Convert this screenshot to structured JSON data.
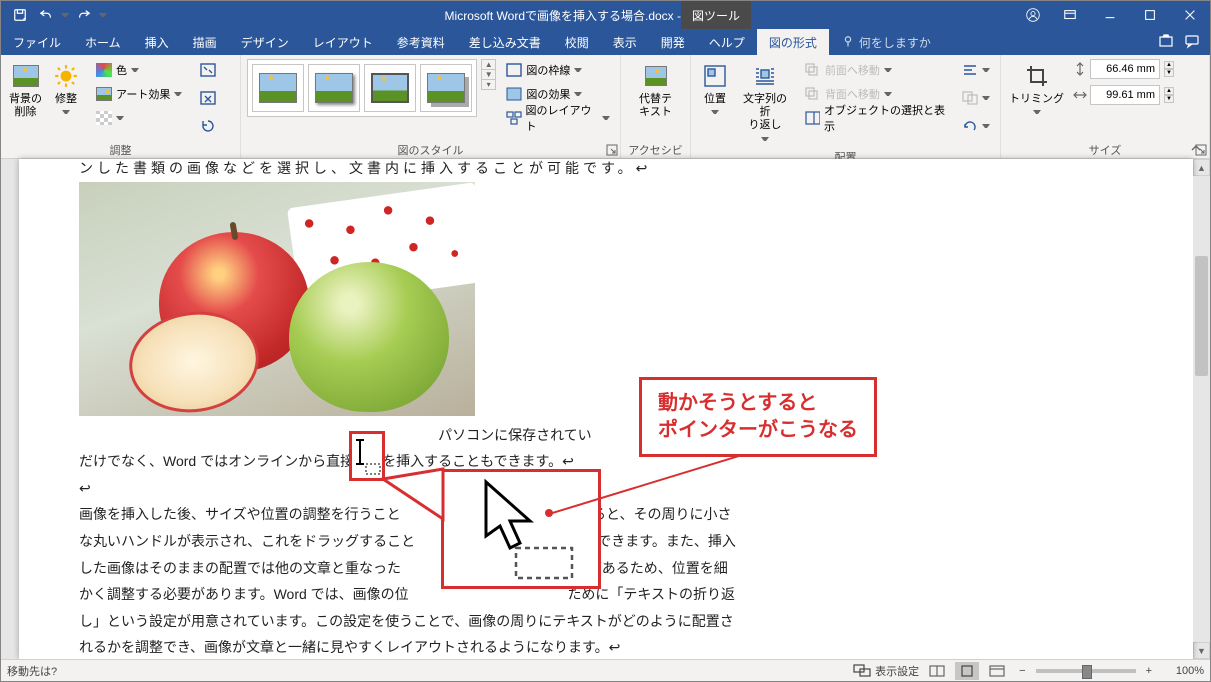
{
  "titlebar": {
    "doc_title": "Microsoft Wordで画像を挿入する場合.docx  -  Word",
    "tool_tab": "図ツール"
  },
  "tabs": {
    "file": "ファイル",
    "home": "ホーム",
    "insert": "挿入",
    "draw": "描画",
    "design": "デザイン",
    "layout": "レイアウト",
    "references": "参考資料",
    "mailings": "差し込み文書",
    "review": "校閲",
    "view": "表示",
    "developer": "開発",
    "help": "ヘルプ",
    "format": "図の形式",
    "tell_me": "何をしますか"
  },
  "ribbon": {
    "remove_bg": "背景の\n削除",
    "corrections": "修整",
    "color": "色",
    "art_effects": "アート効果",
    "group_adjust": "調整",
    "group_styles": "図のスタイル",
    "border": "図の枠線",
    "effects": "図の効果",
    "layout_pic": "図のレイアウト",
    "alt_text": "代替テ\nキスト",
    "group_accessibility": "アクセシビリティ",
    "position": "位置",
    "wrap": "文字列の折\nり返し",
    "bring_forward": "前面へ移動",
    "send_backward": "背面へ移動",
    "selection_pane": "オブジェクトの選択と表示",
    "group_arrange": "配置",
    "crop": "トリミング",
    "height_value": "66.46 mm",
    "width_value": "99.61 mm",
    "group_size": "サイズ"
  },
  "doc": {
    "line1": "ンした書類の画像などを選択し、文書内に挿入することが可能です。",
    "line2_left": "だけでなく、Word ではオンラインから",
    "line2_mid": "直接",
    "line2_right": "画像を挿入することもできます。",
    "line2_pre": "パソコンに保存されてい",
    "p1a": "画像を挿入した後、サイズや位置の調整を行うこと",
    "p1b": "ックすると、その周りに小さ",
    "p2a": "な丸いハンドルが表示され、これをドラッグすること",
    "p2b": "に変更できます。また、挿入",
    "p3a": "した画像はそのままの配置では他の文章と重なった",
    "p3b": "ことがあるため、位置を細",
    "p4": "かく調整する必要があります。Word では、画像の位",
    "p4b": "ために「テキストの折り返",
    "p5": "し」という設定が用意されています。この設定を使うことで、画像の周りにテキストがどのように配置さ",
    "p6": "れるかを調整でき、画像が文章と一緒に見やすくレイアウトされるようになります。"
  },
  "annotation": {
    "bubble_line1": "動かそうとすると",
    "bubble_line2": "ポインターがこうなる"
  },
  "statusbar": {
    "left": "移動先は?",
    "display_settings": "表示設定",
    "zoom": "100%"
  }
}
